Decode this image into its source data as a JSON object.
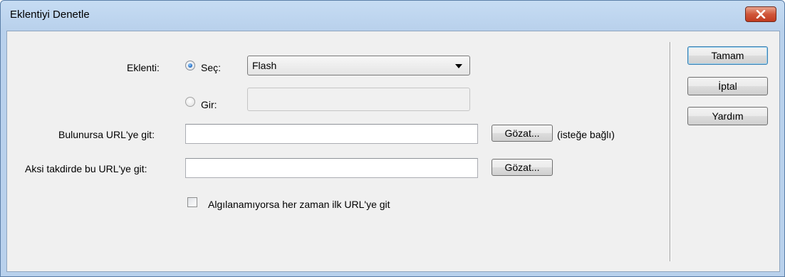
{
  "window": {
    "title": "Eklentiyi Denetle"
  },
  "form": {
    "plugin_label": "Eklenti:",
    "choose_label": "Seç:",
    "choose_selected": true,
    "select_value": "Flash",
    "enter_label": "Gir:",
    "enter_value": "",
    "found_url_label": "Bulunursa URL'ye git:",
    "found_url_value": "",
    "browse1_label": "Gözat...",
    "optional_note": "(isteğe bağlı)",
    "else_url_label": "Aksi takdirde bu URL'ye git:",
    "else_url_value": "",
    "browse2_label": "Gözat...",
    "always_checkbox_label": "Algılanamıyorsa her zaman ilk URL'ye git",
    "always_checkbox_checked": false
  },
  "buttons": {
    "ok_label": "Tamam",
    "cancel_label": "İptal",
    "help_label": "Yardım"
  },
  "colors": {
    "title_bar": "#b9d1ec",
    "client_bg": "#f0f0f0",
    "close_button": "#c9462c"
  }
}
